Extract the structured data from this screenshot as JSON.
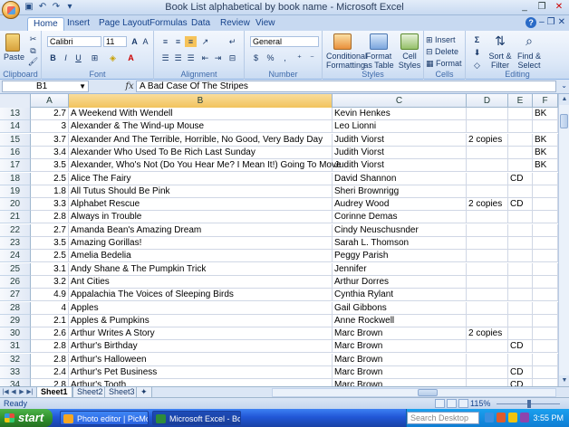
{
  "window": {
    "title": "Book List alphabetical by book name - Microsoft Excel",
    "controls": [
      "_",
      "❐",
      "✕"
    ],
    "qat_icons": [
      "save-icon",
      "undo-icon",
      "redo-icon",
      "customize-icon"
    ]
  },
  "ribbon": {
    "tabs": [
      "Home",
      "Insert",
      "Page Layout",
      "Formulas",
      "Data",
      "Review",
      "View"
    ],
    "active_tab": "Home",
    "clipboard": {
      "label": "Clipboard",
      "paste": "Paste"
    },
    "font": {
      "label": "Font",
      "name": "Calibri",
      "size": "11"
    },
    "alignment": {
      "label": "Alignment"
    },
    "number": {
      "label": "Number",
      "format": "General"
    },
    "styles": {
      "label": "Styles",
      "conditional": "Conditional\nFormatting",
      "format_table": "Format\nas Table",
      "cell_styles": "Cell\nStyles"
    },
    "cells": {
      "label": "Cells",
      "insert": "Insert",
      "delete": "Delete",
      "format": "Format"
    },
    "editing": {
      "label": "Editing",
      "sort": "Sort &\nFilter",
      "find": "Find &\nSelect"
    }
  },
  "formula_bar": {
    "name_box": "B1",
    "fx": "fx",
    "content": "A Bad Case Of The Stripes"
  },
  "columns": [
    "A",
    "B",
    "C",
    "D",
    "E",
    "F"
  ],
  "selected_column": "B",
  "rows": [
    {
      "n": "13",
      "a": "2.7",
      "b": "A Weekend With Wendell",
      "c": "Kevin Henkes",
      "d": "",
      "e": "",
      "f": "BK"
    },
    {
      "n": "14",
      "a": "3",
      "b": "Alexander & The Wind-up Mouse",
      "c": "Leo Lionni",
      "d": "",
      "e": "",
      "f": ""
    },
    {
      "n": "15",
      "a": "3.7",
      "b": "Alexander And The Terrible, Horrible, No Good, Very Bady Day",
      "c": "Judith Viorst",
      "d": "2 copies",
      "e": "",
      "f": "BK"
    },
    {
      "n": "16",
      "a": "3.4",
      "b": "Alexander Who Used To Be Rich Last Sunday",
      "c": "Judith Viorst",
      "d": "",
      "e": "",
      "f": "BK"
    },
    {
      "n": "17",
      "a": "3.5",
      "b": "Alexander, Who's Not (Do You Hear Me? I Mean It!) Going To Move",
      "c": "Judith Viorst",
      "d": "",
      "e": "",
      "f": "BK"
    },
    {
      "n": "18",
      "a": "2.5",
      "b": "Alice The Fairy",
      "c": "David Shannon",
      "d": "",
      "e": "CD",
      "f": ""
    },
    {
      "n": "19",
      "a": "1.8",
      "b": "All Tutus Should Be Pink",
      "c": "Sheri Brownrigg",
      "d": "",
      "e": "",
      "f": ""
    },
    {
      "n": "20",
      "a": "3.3",
      "b": "Alphabet Rescue",
      "c": "Audrey Wood",
      "d": "2 copies",
      "e": "CD",
      "f": ""
    },
    {
      "n": "21",
      "a": "2.8",
      "b": "Always in Trouble",
      "c": "Corinne Demas",
      "d": "",
      "e": "",
      "f": ""
    },
    {
      "n": "22",
      "a": "2.7",
      "b": "Amanda Bean's Amazing Dream",
      "c": "Cindy Neuschusnder",
      "d": "",
      "e": "",
      "f": ""
    },
    {
      "n": "23",
      "a": "3.5",
      "b": "Amazing Gorillas!",
      "c": "Sarah L. Thomson",
      "d": "",
      "e": "",
      "f": ""
    },
    {
      "n": "24",
      "a": "2.5",
      "b": "Amelia Bedelia",
      "c": "Peggy Parish",
      "d": "",
      "e": "",
      "f": ""
    },
    {
      "n": "25",
      "a": "3.1",
      "b": "Andy Shane & The Pumpkin Trick",
      "c": "Jennifer",
      "d": "",
      "e": "",
      "f": ""
    },
    {
      "n": "26",
      "a": "3.2",
      "b": "Ant Cities",
      "c": "Arthur Dorres",
      "d": "",
      "e": "",
      "f": ""
    },
    {
      "n": "27",
      "a": "4.9",
      "b": "Appalachia The Voices of Sleeping Birds",
      "c": "Cynthia Rylant",
      "d": "",
      "e": "",
      "f": ""
    },
    {
      "n": "28",
      "a": "4",
      "b": "Apples",
      "c": "Gail Gibbons",
      "d": "",
      "e": "",
      "f": ""
    },
    {
      "n": "29",
      "a": "2.1",
      "b": "Apples & Pumpkins",
      "c": "Anne Rockwell",
      "d": "",
      "e": "",
      "f": ""
    },
    {
      "n": "30",
      "a": "2.6",
      "b": "Arthur Writes A Story",
      "c": "Marc Brown",
      "d": "2 copies",
      "e": "",
      "f": ""
    },
    {
      "n": "31",
      "a": "2.8",
      "b": "Arthur's Birthday",
      "c": "Marc Brown",
      "d": "",
      "e": "CD",
      "f": ""
    },
    {
      "n": "32",
      "a": "2.8",
      "b": "Arthur's Halloween",
      "c": "Marc Brown",
      "d": "",
      "e": "",
      "f": ""
    },
    {
      "n": "33",
      "a": "2.4",
      "b": "Arthur's Pet Business",
      "c": "Marc Brown",
      "d": "",
      "e": "CD",
      "f": ""
    },
    {
      "n": "34",
      "a": "2.8",
      "b": "Arthur's Tooth",
      "c": "Marc Brown",
      "d": "",
      "e": "CD",
      "f": ""
    }
  ],
  "sheets": [
    "Sheet1",
    "Sheet2",
    "Sheet3"
  ],
  "active_sheet": "Sheet1",
  "status": {
    "text": "Ready",
    "zoom": "115%"
  },
  "taskbar": {
    "start": "start",
    "items": [
      "Photo editor | PicMon...",
      "Microsoft Excel - Boo..."
    ],
    "search_placeholder": "Search Desktop",
    "clock": "3:55 PM"
  },
  "colors": {
    "accent": "#15428b",
    "ribbon": "#dbe7f7",
    "taskbar": "#2157d6",
    "start": "#2f8f2c"
  }
}
